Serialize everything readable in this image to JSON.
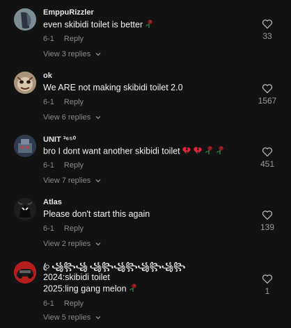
{
  "comments": [
    {
      "username": "EmppuRizzler",
      "text": "even skibidi toilet is better",
      "date": "6-1",
      "reply_label": "Reply",
      "view_replies": "View 3 replies",
      "likes": "33",
      "avatar_color": "#6f7f86"
    },
    {
      "username": "ok",
      "text": "We ARE not making skibidi toilet 2.0",
      "date": "6-1",
      "reply_label": "Reply",
      "view_replies": "View 6 replies",
      "likes": "1567",
      "avatar_color": "#b8a68c"
    },
    {
      "username": "UNIT ³⁶⁵⁰",
      "text": "bro I dont want another skibidi toilet",
      "date": "6-1",
      "reply_label": "Reply",
      "view_replies": "View 7 replies",
      "likes": "451",
      "avatar_color": "#3d4a5c"
    },
    {
      "username": "Atlas",
      "text": "Please don't start this again",
      "date": "6-1",
      "reply_label": "Reply",
      "view_replies": "View 2 replies",
      "likes": "139",
      "avatar_color": "#2a2a2a"
    },
    {
      "username": "ꦿ ꧁꧂꧁ ꧁꧂꧁꧂꧁꧂꧁꧂",
      "text_line1": "2024:skibidi toilet",
      "text_line2": "2025:ling gang melon",
      "date": "6-1",
      "reply_label": "Reply",
      "view_replies": "View 5 replies",
      "likes": "1",
      "avatar_color": "#c42222"
    }
  ],
  "colors": {
    "background": "#121212",
    "muted": "#8a8a8a",
    "heart_red": "#e0243c",
    "rose_green": "#2e7d4a"
  },
  "icons": {
    "like": "heart-outline-icon",
    "chevron": "chevron-down-icon",
    "rose": "wilted-rose-emoji",
    "heart": "broken-heart-emoji"
  }
}
